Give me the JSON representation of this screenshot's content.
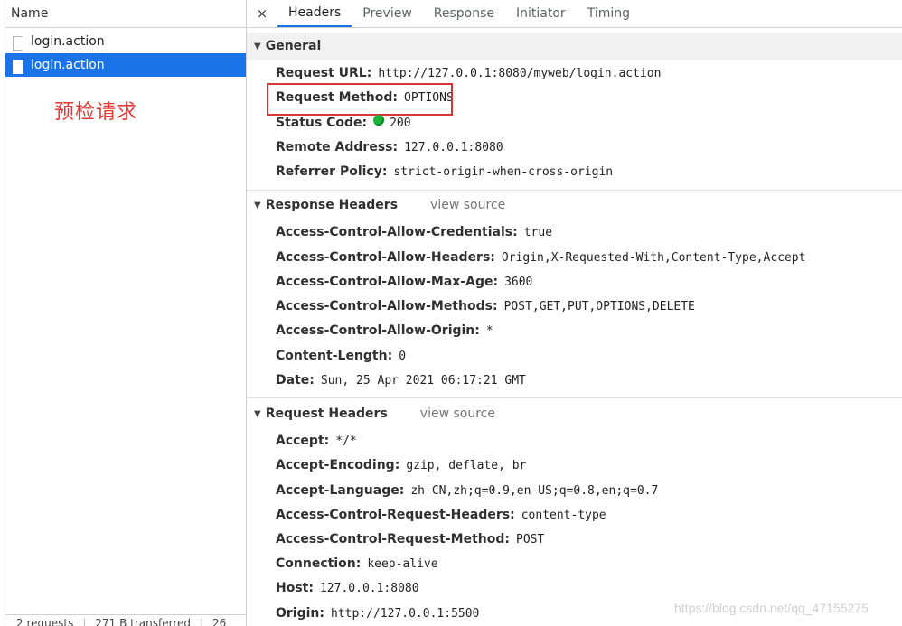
{
  "left": {
    "column_header": "Name",
    "requests": [
      {
        "name": "login.action",
        "selected": false
      },
      {
        "name": "login.action",
        "selected": true
      }
    ],
    "annotation": "预检请求",
    "status": [
      "2 requests",
      "271 B transferred",
      "26"
    ]
  },
  "tabs": {
    "close": "×",
    "items": [
      "Headers",
      "Preview",
      "Response",
      "Initiator",
      "Timing"
    ],
    "active": "Headers"
  },
  "general": {
    "title": "General",
    "rows": [
      {
        "key": "Request URL",
        "value": "http://127.0.0.1:8080/myweb/login.action"
      },
      {
        "key": "Request Method",
        "value": "OPTIONS"
      },
      {
        "key": "Status Code",
        "value": "200"
      },
      {
        "key": "Remote Address",
        "value": "127.0.0.1:8080"
      },
      {
        "key": "Referrer Policy",
        "value": "strict-origin-when-cross-origin"
      }
    ]
  },
  "response_headers": {
    "title": "Response Headers",
    "view_source": "view source",
    "rows": [
      {
        "key": "Access-Control-Allow-Credentials",
        "value": "true"
      },
      {
        "key": "Access-Control-Allow-Headers",
        "value": "Origin,X-Requested-With,Content-Type,Accept"
      },
      {
        "key": "Access-Control-Allow-Max-Age",
        "value": "3600"
      },
      {
        "key": "Access-Control-Allow-Methods",
        "value": "POST,GET,PUT,OPTIONS,DELETE"
      },
      {
        "key": "Access-Control-Allow-Origin",
        "value": "*"
      },
      {
        "key": "Content-Length",
        "value": "0"
      },
      {
        "key": "Date",
        "value": "Sun, 25 Apr 2021 06:17:21 GMT"
      }
    ]
  },
  "request_headers": {
    "title": "Request Headers",
    "view_source": "view source",
    "rows": [
      {
        "key": "Accept",
        "value": "*/*"
      },
      {
        "key": "Accept-Encoding",
        "value": "gzip, deflate, br"
      },
      {
        "key": "Accept-Language",
        "value": "zh-CN,zh;q=0.9,en-US;q=0.8,en;q=0.7"
      },
      {
        "key": "Access-Control-Request-Headers",
        "value": "content-type"
      },
      {
        "key": "Access-Control-Request-Method",
        "value": "POST"
      },
      {
        "key": "Connection",
        "value": "keep-alive"
      },
      {
        "key": "Host",
        "value": "127.0.0.1:8080"
      },
      {
        "key": "Origin",
        "value": "http://127.0.0.1:5500"
      }
    ]
  },
  "colors": {
    "selected_row": "#1a73e8",
    "annotation": "#e53935",
    "highlight_box": "#d93636",
    "status_ok": "#18b53a"
  },
  "watermark": "https://blog.csdn.net/qq_47155275"
}
